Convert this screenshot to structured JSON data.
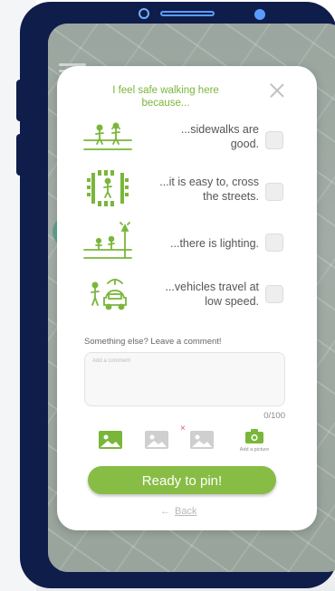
{
  "dialog": {
    "title": "I feel safe walking here because...",
    "options": [
      {
        "label": "...sidewalks are good.",
        "icon": "pedestrians-on-sidewalk-icon",
        "checked": false
      },
      {
        "label": "...it is easy to, cross the streets.",
        "icon": "crosswalk-icon",
        "checked": false
      },
      {
        "label": "...there is lighting.",
        "icon": "street-lighting-icon",
        "checked": false
      },
      {
        "label": "...vehicles travel at low speed.",
        "icon": "slow-vehicle-icon",
        "checked": false
      }
    ],
    "comment": {
      "label": "Something else? Leave a comment!",
      "placeholder": "Add a comment",
      "value": "",
      "counter": "0/100"
    },
    "pictures": {
      "add_label": "Add a picture",
      "remove_glyph": "×"
    },
    "pin_button": "Ready to pin!",
    "back_arrow": "←",
    "back_label": "Back"
  },
  "colors": {
    "accent_green": "#88bd45",
    "title_green": "#7ab63a",
    "phone_navy": "#0f1d4a",
    "remove_red": "#e0556c"
  }
}
